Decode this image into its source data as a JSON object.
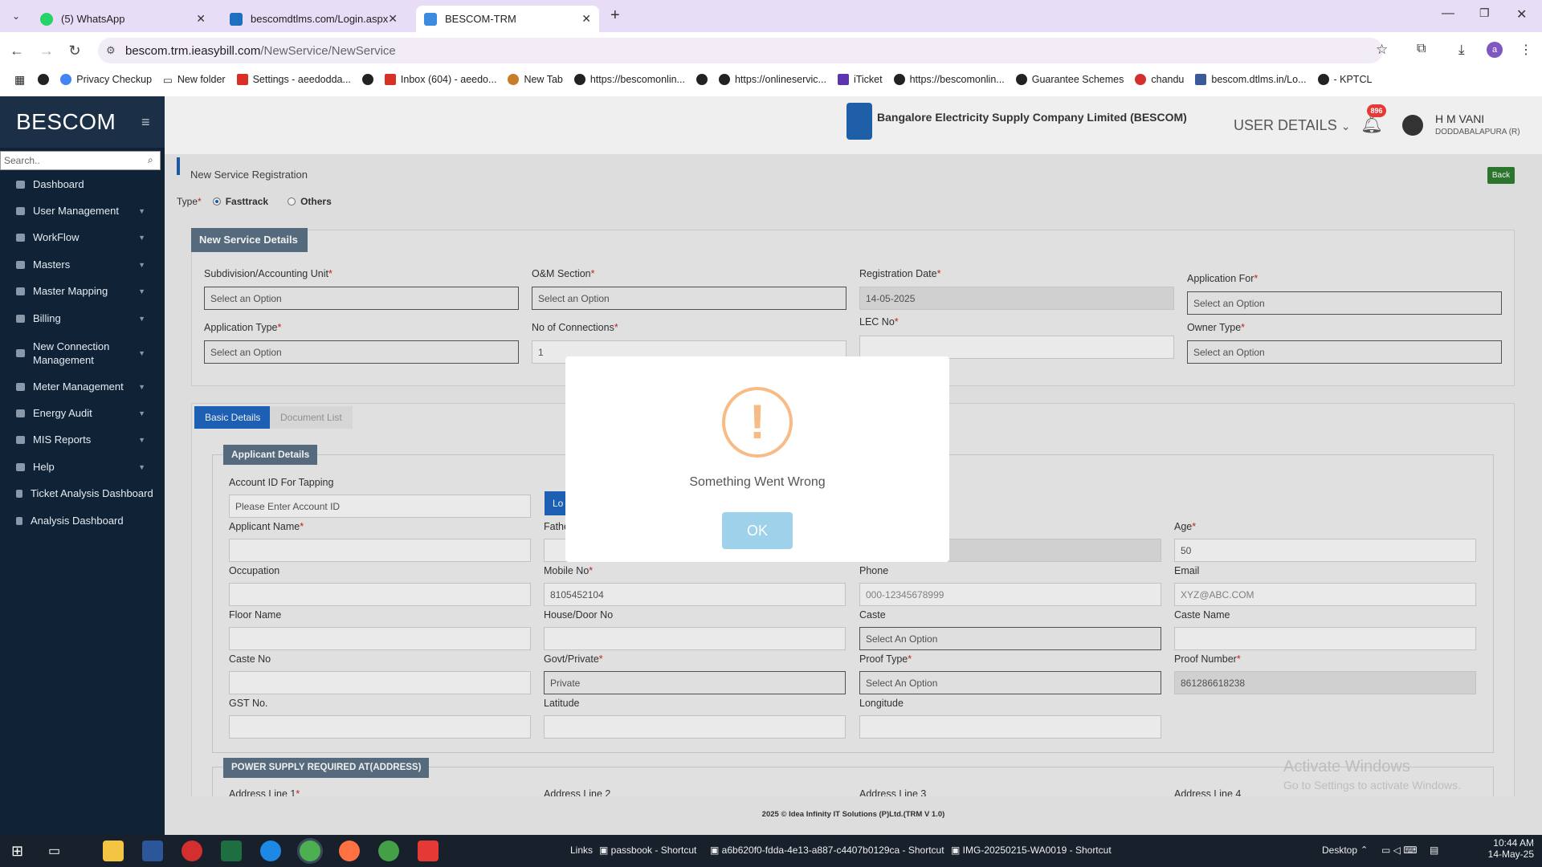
{
  "browser": {
    "tabs": [
      {
        "title": "(5) WhatsApp"
      },
      {
        "title": "bescomdtlms.com/Login.aspx"
      },
      {
        "title": "BESCOM-TRM"
      }
    ],
    "url_host": "bescom.trm.ieasybill.com",
    "url_path": "/NewService/NewService",
    "bookmarks": [
      "Privacy Checkup",
      "New folder",
      "Settings - aeedodda...",
      "Inbox (604) - aeedo...",
      "New Tab",
      "https://bescomonlin...",
      "https://onlineservic...",
      "iTicket",
      "https://bescomonlin...",
      "Guarantee Schemes",
      "chandu",
      "bescom.dtlms.in/Lo...",
      "- KPTCL"
    ],
    "profile_initial": "a"
  },
  "app": {
    "brand": "BESCOM",
    "search_placeholder": "Search..",
    "nav": [
      {
        "label": "Dashboard",
        "expandable": false
      },
      {
        "label": "User Management",
        "expandable": true
      },
      {
        "label": "WorkFlow",
        "expandable": true
      },
      {
        "label": "Masters",
        "expandable": true
      },
      {
        "label": "Master Mapping",
        "expandable": true
      },
      {
        "label": "Billing",
        "expandable": true
      },
      {
        "label": "New Connection Management",
        "expandable": true
      },
      {
        "label": "Meter Management",
        "expandable": true
      },
      {
        "label": "Energy Audit",
        "expandable": true
      },
      {
        "label": "MIS Reports",
        "expandable": true
      },
      {
        "label": "Help",
        "expandable": true
      },
      {
        "label": "Ticket Analysis Dashboard",
        "expandable": false
      },
      {
        "label": "Analysis Dashboard",
        "expandable": false
      }
    ],
    "company": "Bangalore Electricity Supply Company Limited (BESCOM)",
    "user_details_label": "USER DETAILS",
    "notification_count": "896",
    "user_name": "H M VANI",
    "user_location": "DODDABALAPURA (R)"
  },
  "page": {
    "title": "New Service Registration",
    "back_label": "Back",
    "type_label": "Type",
    "type_options": [
      "Fasttrack",
      "Others"
    ],
    "type_selected": "Fasttrack",
    "service_section_title": "New Service Details",
    "service_fields": {
      "subdivision": {
        "label": "Subdivision/Accounting Unit",
        "value": "Select an Option"
      },
      "om_section": {
        "label": "O&M Section",
        "value": "Select an Option"
      },
      "registration_date": {
        "label": "Registration Date",
        "value": "14-05-2025"
      },
      "application_for": {
        "label": "Application For",
        "value": "Select an Option"
      },
      "application_type": {
        "label": "Application Type",
        "value": "Select an Option"
      },
      "no_of_connections": {
        "label": "No of Connections",
        "value": "1"
      },
      "lec_no": {
        "label": "LEC No",
        "value": ""
      },
      "owner_type": {
        "label": "Owner Type",
        "value": "Select an Option"
      }
    },
    "tabs": [
      "Basic Details",
      "Document List"
    ],
    "applicant_section_title": "Applicant Details",
    "account_id": {
      "label": "Account ID For Tapping",
      "placeholder": "Please Enter Account ID",
      "button": "Lo"
    },
    "applicant_fields": {
      "applicant_name": {
        "label": "Applicant Name",
        "value": ""
      },
      "father_name": {
        "label": "Fathe",
        "value": ""
      },
      "age": {
        "label": "Age",
        "value": "50"
      },
      "occupation": {
        "label": "Occupation",
        "value": ""
      },
      "mobile_no": {
        "label": "Mobile No",
        "value": "8105452104"
      },
      "phone": {
        "label": "Phone",
        "value": "000-12345678999"
      },
      "email": {
        "label": "Email",
        "value": "XYZ@ABC.COM"
      },
      "floor_name": {
        "label": "Floor Name",
        "value": ""
      },
      "house_door_no": {
        "label": "House/Door No",
        "value": ""
      },
      "caste": {
        "label": "Caste",
        "value": "Select An Option"
      },
      "caste_name": {
        "label": "Caste Name",
        "value": ""
      },
      "caste_no": {
        "label": "Caste No",
        "value": ""
      },
      "govt_private": {
        "label": "Govt/Private",
        "value": "Private"
      },
      "proof_type": {
        "label": "Proof Type",
        "value": "Select An Option"
      },
      "proof_number": {
        "label": "Proof Number",
        "value": "861286618238"
      },
      "gst_no": {
        "label": "GST No.",
        "value": ""
      },
      "latitude": {
        "label": "Latitude",
        "value": ""
      },
      "longitude": {
        "label": "Longitude",
        "value": ""
      }
    },
    "address_section_title": "POWER SUPPLY REQUIRED AT(ADDRESS)",
    "address_labels": [
      "Address Line 1",
      "Address Line 2",
      "Address Line 3",
      "Address Line 4"
    ],
    "footer": "2025 © Idea Infinity IT Solutions (P)Ltd.(TRM V 1.0)",
    "watermark_title": "Activate Windows",
    "watermark_sub": "Go to Settings to activate Windows."
  },
  "modal": {
    "icon": "!",
    "message": "Something Went Wrong",
    "ok_label": "OK"
  },
  "taskbar": {
    "links_label": "Links",
    "shortcuts": [
      "passbook - Shortcut",
      "a6b620f0-fdda-4e13-a887-c4407b0129ca - Shortcut",
      "IMG-20250215-WA0019 - Shortcut"
    ],
    "desktop_label": "Desktop",
    "time": "10:44 AM",
    "date": "14-May-25"
  },
  "colors": {
    "sidebar": "#102235",
    "accent": "#1e5fa8",
    "warning": "#f8bb86",
    "ok_button": "#9dd2ea",
    "back_button": "#2e7d32"
  }
}
